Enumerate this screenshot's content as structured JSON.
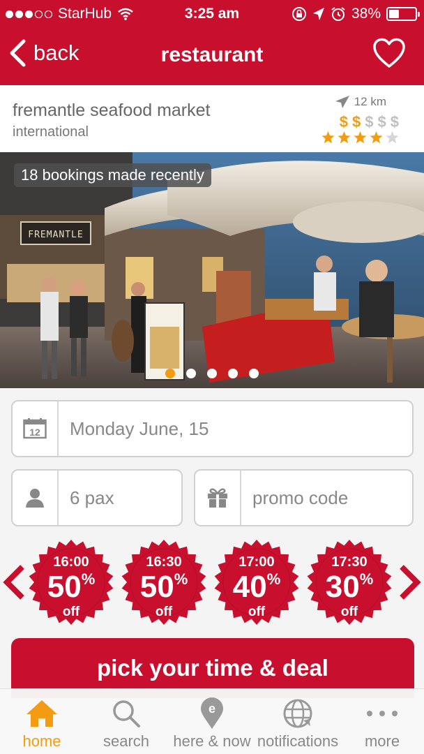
{
  "status_bar": {
    "carrier": "StarHub",
    "time": "3:25 am",
    "battery": "38%",
    "battery_level": 0.38,
    "signal_bars": 3,
    "signal_total": 5
  },
  "nav": {
    "back_label": "back",
    "title": "restaurant"
  },
  "restaurant": {
    "name": "fremantle seafood market",
    "cuisine": "international",
    "distance": "12 km",
    "price_symbols": [
      "$",
      "$",
      "$",
      "$",
      "$"
    ],
    "price_level": 2,
    "rating": 4,
    "rating_max": 5,
    "colors": {
      "price_active": "#f39c12",
      "price_inactive": "#c0c0c0",
      "star_active": "#f39c12",
      "star_inactive": "#d6d6d6"
    }
  },
  "photo": {
    "badge": "18 bookings made recently",
    "sign_text": "FREMANTLE",
    "slides": 5,
    "active_slide": 0
  },
  "form": {
    "date_icon_number": "12",
    "date": "Monday June, 15",
    "pax": "6 pax",
    "promo_placeholder": "promo code"
  },
  "deals": [
    {
      "time": "16:00",
      "percent": "50",
      "percent_sign": "%",
      "off": "off"
    },
    {
      "time": "16:30",
      "percent": "50",
      "percent_sign": "%",
      "off": "off"
    },
    {
      "time": "17:00",
      "percent": "40",
      "percent_sign": "%",
      "off": "off"
    },
    {
      "time": "17:30",
      "percent": "30",
      "percent_sign": "%",
      "off": "off"
    }
  ],
  "cta": {
    "label": "pick your time & deal"
  },
  "tabbar": {
    "items": [
      {
        "label": "home",
        "icon": "home-icon",
        "active": true
      },
      {
        "label": "search",
        "icon": "search-icon",
        "active": false
      },
      {
        "label": "here & now",
        "icon": "location-pin-icon",
        "active": false
      },
      {
        "label": "notifications",
        "icon": "globe-icon",
        "active": false
      },
      {
        "label": "more",
        "icon": "more-dots-icon",
        "active": false
      }
    ]
  },
  "colors": {
    "brand_red": "#c8102e",
    "accent_orange": "#f39c12"
  }
}
